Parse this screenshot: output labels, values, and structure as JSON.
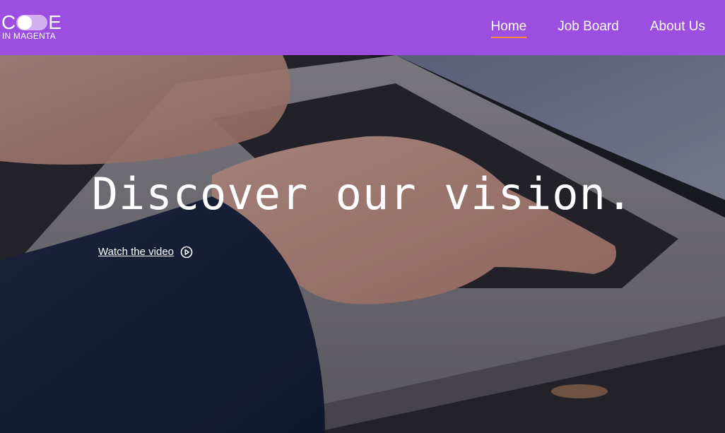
{
  "header": {
    "logo": {
      "letter_c": "C",
      "letter_e": "E",
      "subtitle": "IN MAGENTA",
      "icon": "toggle-switch-icon"
    },
    "nav": [
      {
        "label": "Home",
        "active": true
      },
      {
        "label": "Job Board",
        "active": false
      },
      {
        "label": "About Us",
        "active": false
      }
    ]
  },
  "hero": {
    "title": "Discover our vision.",
    "link_label": "Watch the video",
    "link_icon": "play-circle-icon",
    "background": "photo of hands typing on a laptop keyboard"
  },
  "colors": {
    "header_bg": "#9b4ee0",
    "active_underline": "#ff8a3c",
    "text": "#ffffff"
  }
}
